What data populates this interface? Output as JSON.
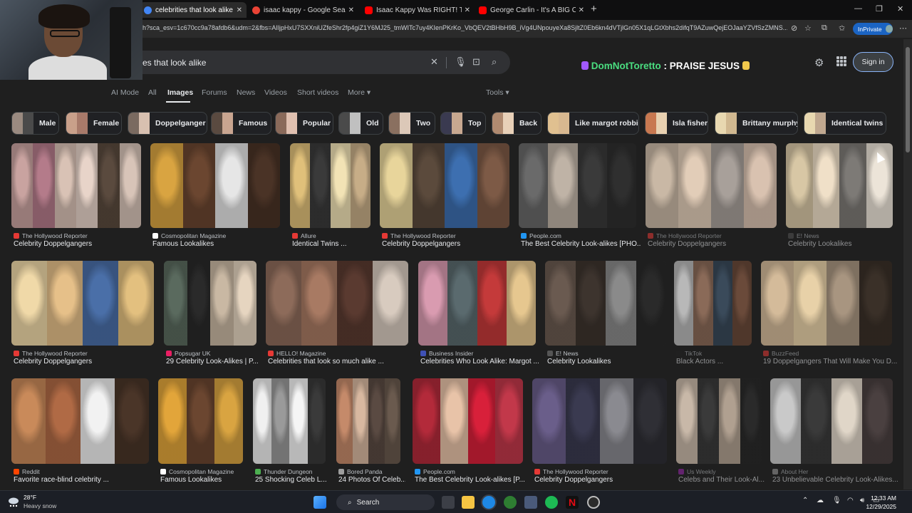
{
  "browser": {
    "tabs": [
      {
        "label": "celebrities that look alike - Google",
        "fav_color": "#4285f4",
        "active": true
      },
      {
        "label": "isaac kappy - Google Search",
        "fav_color": "#ea4335",
        "active": false
      },
      {
        "label": "Isaac Kappy Was RIGHT! Tom Hank",
        "fav_color": "#ff0000",
        "active": false
      },
      {
        "label": "George Carlin - It's A BIG Club & Y",
        "fav_color": "#ff0000",
        "active": false
      }
    ],
    "url": "h?sca_esv=1c670cc9a78afdb6&udm=2&fbs=AIljpHxU7SXXniUZfeShr2fp4giZ1Y6MJ25_tmWITc7uy4KIenPKrKo_VbQEV2tBHbH9B_iVg4UNpouyeXa8SjltZ0Eb6kn4dVTjlGn05X1qLGtXbhs2difqT9AZuwQejEOJaaYZVfSzZMNS...",
    "inprivate_label": "InPrivate"
  },
  "search": {
    "query": "es that look alike",
    "banner_user": "DomNotToretto",
    "banner_text": " : PRAISE JESUS ",
    "sign_in": "Sign in"
  },
  "nav": {
    "tabs": [
      "AI Mode",
      "All",
      "Images",
      "Forums",
      "News",
      "Videos",
      "Short videos",
      "More ▾"
    ],
    "active": "Images",
    "tools": "Tools ▾"
  },
  "chips": [
    "Male",
    "Female",
    "Doppelganger",
    "Famous",
    "Popular",
    "Old",
    "Two",
    "Top",
    "Back",
    "Like margot robbie",
    "Isla fisher",
    "Brittany murphy",
    "Identical twins"
  ],
  "results": [
    {
      "source": "The Hollywood Reporter",
      "title": "Celebrity Doppelgangers",
      "fav": "#e53935",
      "colors": [
        "#c9a3a0",
        "#b47b8a",
        "#d9c2b5",
        "#e8d4c9",
        "#5a4a3e",
        "#d8c4b8"
      ]
    },
    {
      "source": "Cosmopolitan Magazine",
      "title": "Famous Lookalikes",
      "fav": "#ffffff",
      "colors": [
        "#d9a441",
        "#6b4630",
        "#e6e6e6",
        "#4a3326"
      ]
    },
    {
      "source": "Allure",
      "title": "Identical Twins ...",
      "fav": "#e53935",
      "colors": [
        "#e0c07a",
        "#3a3a3a",
        "#f2e3b5",
        "#c7ad87"
      ]
    },
    {
      "source": "The Hollywood Reporter",
      "title": "Celebrity Doppelgangers",
      "fav": "#e53935",
      "colors": [
        "#e8d59b",
        "#5b4a3c",
        "#3d6fb0",
        "#7d5a46"
      ]
    },
    {
      "source": "People.com",
      "title": "The Best Celebrity Look-alikes [PHO...",
      "fav": "#2196f3",
      "colors": [
        "#6a6a6a",
        "#bfb3a6",
        "#3a3a3a",
        "#2f2f2f"
      ]
    },
    {
      "source": "The Hollywood Reporter",
      "title": "Celebrity Doppelgangers",
      "fav": "#e53935",
      "colors": [
        "#c9b8a5",
        "#e2cdb8",
        "#a8a09a",
        "#d9c2b0"
      ]
    },
    {
      "source": "E! News",
      "title": "Celebrity Lookalikes",
      "fav": "#555555",
      "colors": [
        "#d8c7a5",
        "#f0e0c8",
        "#7d7a76",
        "#ece4d8"
      ]
    },
    {
      "source": "The Hollywood Reporter",
      "title": "Celebrity Doppelgangers",
      "fav": "#e53935",
      "colors": [
        "#f0d9a8",
        "#e6c089",
        "#4a6fa8",
        "#e3c07f"
      ]
    },
    {
      "source": "Popsugar UK",
      "title": "29 Celebrity Look-Alikes | P...",
      "fav": "#e91e63",
      "colors": [
        "#5a6a5e",
        "#2a2a2a",
        "#c9b8a3",
        "#e6d5c0"
      ]
    },
    {
      "source": "HELLO! Magazine",
      "title": "Celebrities that look so much alike ...",
      "fav": "#e53935",
      "colors": [
        "#8d6b5a",
        "#a87a63",
        "#5a3a30",
        "#d8cbbf"
      ]
    },
    {
      "source": "Business Insider",
      "title": "Celebrities Who Look Alike: Margot ...",
      "fav": "#3f51b5",
      "colors": [
        "#d99bb0",
        "#5a6a6e",
        "#c43a3a",
        "#e6c78f"
      ]
    },
    {
      "source": "E! News",
      "title": "Celebrity Lookalikes",
      "fav": "#555555",
      "colors": [
        "#6a5a50",
        "#3d342e",
        "#8a8a8a",
        "#2a2a2a"
      ]
    },
    {
      "source": "TikTok",
      "title": "Black Actors ...",
      "fav": "#222222",
      "colors": [
        "#b8b8b8",
        "#8a6a58",
        "#3a4a5a",
        "#6a4a3a"
      ]
    },
    {
      "source": "BuzzFeed",
      "title": "19 Doppelgangers That Will Make You D...",
      "fav": "#e53935",
      "colors": [
        "#d4bb9a",
        "#e8d1a8",
        "#a89580",
        "#3a3028"
      ]
    },
    {
      "source": "Reddit",
      "title": "Favorite race-blind celebrity ...",
      "fav": "#ff4500",
      "colors": [
        "#c98a5a",
        "#b06a45",
        "#f2f2f2",
        "#4a3528"
      ]
    },
    {
      "source": "Cosmopolitan Magazine",
      "title": "Famous Lookalikes",
      "fav": "#ffffff",
      "colors": [
        "#e2a53a",
        "#6b4630",
        "#d9a441"
      ]
    },
    {
      "source": "Thunder Dungeon",
      "title": "25 Shocking Celeb L...",
      "fav": "#4caf50",
      "colors": [
        "#f0f0f0",
        "#9a9a9a",
        "#f5f5f5",
        "#3a3a3a"
      ]
    },
    {
      "source": "Bored Panda",
      "title": "24 Photos Of Celeb...",
      "fav": "#9e9e9e",
      "colors": [
        "#c58a6a",
        "#d8b8a0",
        "#5a4a42",
        "#6a5a4e"
      ]
    },
    {
      "source": "People.com",
      "title": "The Best Celebrity Look-alikes [P...",
      "fav": "#2196f3",
      "colors": [
        "#b32a3a",
        "#e8c3a8",
        "#d8203a",
        "#c2384a"
      ]
    },
    {
      "source": "The Hollywood Reporter",
      "title": "Celebrity Doppelgangers",
      "fav": "#e53935",
      "colors": [
        "#6a5e8a",
        "#3a3a50",
        "#8a8a90",
        "#2f2f35"
      ]
    },
    {
      "source": "Us Weekly",
      "title": "Celebs and Their Look-Al...",
      "fav": "#9c27b0",
      "colors": [
        "#c8b8a8",
        "#3a3a3a",
        "#b0a090",
        "#2a2a2a"
      ]
    },
    {
      "source": "About Her",
      "title": "23 Unbelievable Celebrity Look-Alikes...",
      "fav": "#9e9e9e",
      "colors": [
        "#c9c9c9",
        "#3a3a3a",
        "#e0d6c8",
        "#4a4040"
      ]
    }
  ],
  "taskbar": {
    "temp": "28°F",
    "condition": "Heavy snow",
    "search": "Search",
    "time": "12:33 AM",
    "date": "12/29/2025"
  }
}
